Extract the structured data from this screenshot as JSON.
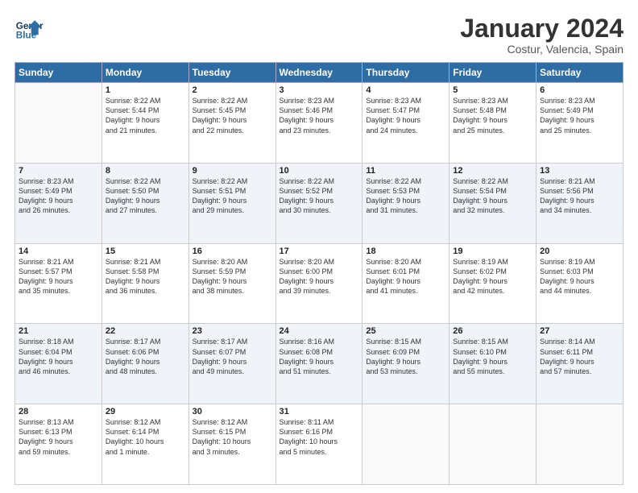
{
  "logo": {
    "line1": "General",
    "line2": "Blue"
  },
  "header": {
    "title": "January 2024",
    "subtitle": "Costur, Valencia, Spain"
  },
  "weekdays": [
    "Sunday",
    "Monday",
    "Tuesday",
    "Wednesday",
    "Thursday",
    "Friday",
    "Saturday"
  ],
  "weeks": [
    [
      {
        "day": "",
        "detail": ""
      },
      {
        "day": "1",
        "detail": "Sunrise: 8:22 AM\nSunset: 5:44 PM\nDaylight: 9 hours\nand 21 minutes."
      },
      {
        "day": "2",
        "detail": "Sunrise: 8:22 AM\nSunset: 5:45 PM\nDaylight: 9 hours\nand 22 minutes."
      },
      {
        "day": "3",
        "detail": "Sunrise: 8:23 AM\nSunset: 5:46 PM\nDaylight: 9 hours\nand 23 minutes."
      },
      {
        "day": "4",
        "detail": "Sunrise: 8:23 AM\nSunset: 5:47 PM\nDaylight: 9 hours\nand 24 minutes."
      },
      {
        "day": "5",
        "detail": "Sunrise: 8:23 AM\nSunset: 5:48 PM\nDaylight: 9 hours\nand 25 minutes."
      },
      {
        "day": "6",
        "detail": "Sunrise: 8:23 AM\nSunset: 5:49 PM\nDaylight: 9 hours\nand 25 minutes."
      }
    ],
    [
      {
        "day": "7",
        "detail": "Sunrise: 8:23 AM\nSunset: 5:49 PM\nDaylight: 9 hours\nand 26 minutes."
      },
      {
        "day": "8",
        "detail": "Sunrise: 8:22 AM\nSunset: 5:50 PM\nDaylight: 9 hours\nand 27 minutes."
      },
      {
        "day": "9",
        "detail": "Sunrise: 8:22 AM\nSunset: 5:51 PM\nDaylight: 9 hours\nand 29 minutes."
      },
      {
        "day": "10",
        "detail": "Sunrise: 8:22 AM\nSunset: 5:52 PM\nDaylight: 9 hours\nand 30 minutes."
      },
      {
        "day": "11",
        "detail": "Sunrise: 8:22 AM\nSunset: 5:53 PM\nDaylight: 9 hours\nand 31 minutes."
      },
      {
        "day": "12",
        "detail": "Sunrise: 8:22 AM\nSunset: 5:54 PM\nDaylight: 9 hours\nand 32 minutes."
      },
      {
        "day": "13",
        "detail": "Sunrise: 8:21 AM\nSunset: 5:56 PM\nDaylight: 9 hours\nand 34 minutes."
      }
    ],
    [
      {
        "day": "14",
        "detail": "Sunrise: 8:21 AM\nSunset: 5:57 PM\nDaylight: 9 hours\nand 35 minutes."
      },
      {
        "day": "15",
        "detail": "Sunrise: 8:21 AM\nSunset: 5:58 PM\nDaylight: 9 hours\nand 36 minutes."
      },
      {
        "day": "16",
        "detail": "Sunrise: 8:20 AM\nSunset: 5:59 PM\nDaylight: 9 hours\nand 38 minutes."
      },
      {
        "day": "17",
        "detail": "Sunrise: 8:20 AM\nSunset: 6:00 PM\nDaylight: 9 hours\nand 39 minutes."
      },
      {
        "day": "18",
        "detail": "Sunrise: 8:20 AM\nSunset: 6:01 PM\nDaylight: 9 hours\nand 41 minutes."
      },
      {
        "day": "19",
        "detail": "Sunrise: 8:19 AM\nSunset: 6:02 PM\nDaylight: 9 hours\nand 42 minutes."
      },
      {
        "day": "20",
        "detail": "Sunrise: 8:19 AM\nSunset: 6:03 PM\nDaylight: 9 hours\nand 44 minutes."
      }
    ],
    [
      {
        "day": "21",
        "detail": "Sunrise: 8:18 AM\nSunset: 6:04 PM\nDaylight: 9 hours\nand 46 minutes."
      },
      {
        "day": "22",
        "detail": "Sunrise: 8:17 AM\nSunset: 6:06 PM\nDaylight: 9 hours\nand 48 minutes."
      },
      {
        "day": "23",
        "detail": "Sunrise: 8:17 AM\nSunset: 6:07 PM\nDaylight: 9 hours\nand 49 minutes."
      },
      {
        "day": "24",
        "detail": "Sunrise: 8:16 AM\nSunset: 6:08 PM\nDaylight: 9 hours\nand 51 minutes."
      },
      {
        "day": "25",
        "detail": "Sunrise: 8:15 AM\nSunset: 6:09 PM\nDaylight: 9 hours\nand 53 minutes."
      },
      {
        "day": "26",
        "detail": "Sunrise: 8:15 AM\nSunset: 6:10 PM\nDaylight: 9 hours\nand 55 minutes."
      },
      {
        "day": "27",
        "detail": "Sunrise: 8:14 AM\nSunset: 6:11 PM\nDaylight: 9 hours\nand 57 minutes."
      }
    ],
    [
      {
        "day": "28",
        "detail": "Sunrise: 8:13 AM\nSunset: 6:13 PM\nDaylight: 9 hours\nand 59 minutes."
      },
      {
        "day": "29",
        "detail": "Sunrise: 8:12 AM\nSunset: 6:14 PM\nDaylight: 10 hours\nand 1 minute."
      },
      {
        "day": "30",
        "detail": "Sunrise: 8:12 AM\nSunset: 6:15 PM\nDaylight: 10 hours\nand 3 minutes."
      },
      {
        "day": "31",
        "detail": "Sunrise: 8:11 AM\nSunset: 6:16 PM\nDaylight: 10 hours\nand 5 minutes."
      },
      {
        "day": "",
        "detail": ""
      },
      {
        "day": "",
        "detail": ""
      },
      {
        "day": "",
        "detail": ""
      }
    ]
  ]
}
